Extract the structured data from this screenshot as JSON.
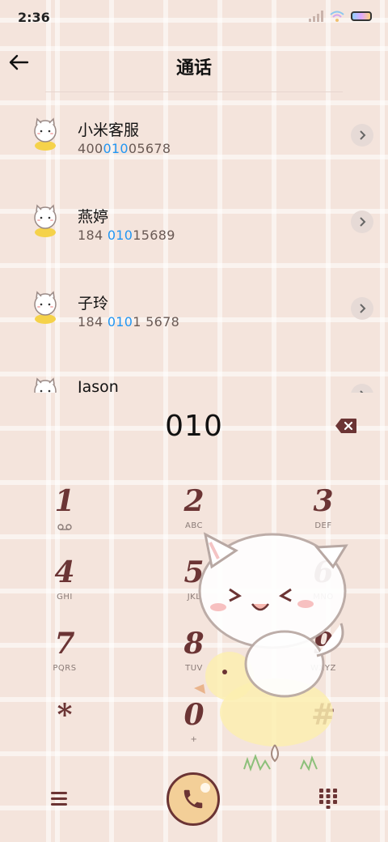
{
  "status": {
    "time": "2:36"
  },
  "header": {
    "title": "通话"
  },
  "contacts": [
    {
      "name": "小米客服",
      "num_pre": "400",
      "num_hl": "010",
      "num_post": "05678"
    },
    {
      "name": "燕婷",
      "num_pre": "184 ",
      "num_hl": "010",
      "num_post": "15689"
    },
    {
      "name": "子玲",
      "num_pre": "184 ",
      "num_hl": "010",
      "num_post": "1 5678"
    },
    {
      "name": "Jason",
      "num_pre": "",
      "num_hl": "",
      "num_post": ""
    }
  ],
  "dialer": {
    "number": "010"
  },
  "keys": [
    {
      "digit": "1",
      "letters": ""
    },
    {
      "digit": "2",
      "letters": "ABC"
    },
    {
      "digit": "3",
      "letters": "DEF"
    },
    {
      "digit": "4",
      "letters": "GHI"
    },
    {
      "digit": "5",
      "letters": "JKL"
    },
    {
      "digit": "6",
      "letters": "MNO"
    },
    {
      "digit": "7",
      "letters": "PQRS"
    },
    {
      "digit": "8",
      "letters": "TUV"
    },
    {
      "digit": "9",
      "letters": "WXYZ"
    },
    {
      "digit": "*",
      "letters": ""
    },
    {
      "digit": "0",
      "letters": "+"
    },
    {
      "digit": "#",
      "letters": ""
    }
  ],
  "icons": {
    "voicemail": "voicemail-icon",
    "back": "back-arrow-icon",
    "backspace": "backspace-icon",
    "call": "phone-icon",
    "menu": "menu-icon",
    "keypad": "keypad-icon"
  },
  "colors": {
    "accent": "#6b3434",
    "highlight": "#2196f3",
    "call_button": "#f3cf98",
    "background": "#f4e4dc"
  }
}
